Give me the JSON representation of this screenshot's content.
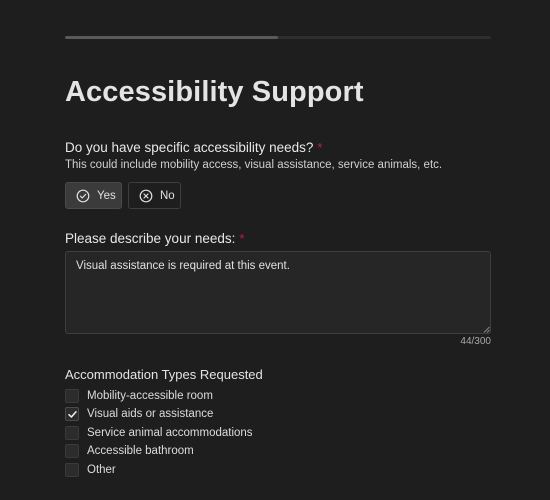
{
  "progress": {
    "fraction": 0.5
  },
  "title": "Accessibility Support",
  "needs_question": {
    "label": "Do you have specific accessibility needs?",
    "required_mark": "*",
    "hint": "This could include mobility access, visual assistance, service animals, etc.",
    "options": [
      {
        "label": "Yes",
        "icon": "check-circle-icon",
        "selected": true
      },
      {
        "label": "No",
        "icon": "x-circle-icon",
        "selected": false
      }
    ]
  },
  "describe": {
    "label": "Please describe your needs:",
    "required_mark": "*",
    "value": "Visual assistance is required at this event.",
    "counter": "44/300"
  },
  "accommodations": {
    "title": "Accommodation Types Requested",
    "items": [
      {
        "label": "Mobility-accessible room",
        "checked": false
      },
      {
        "label": "Visual aids or assistance",
        "checked": true
      },
      {
        "label": "Service animal accommodations",
        "checked": false
      },
      {
        "label": "Accessible bathroom",
        "checked": false
      },
      {
        "label": "Other",
        "checked": false
      }
    ]
  },
  "colors": {
    "background": "#1e1e1e",
    "required": "#c2185b",
    "progress_fill": "#5a5a5a"
  }
}
